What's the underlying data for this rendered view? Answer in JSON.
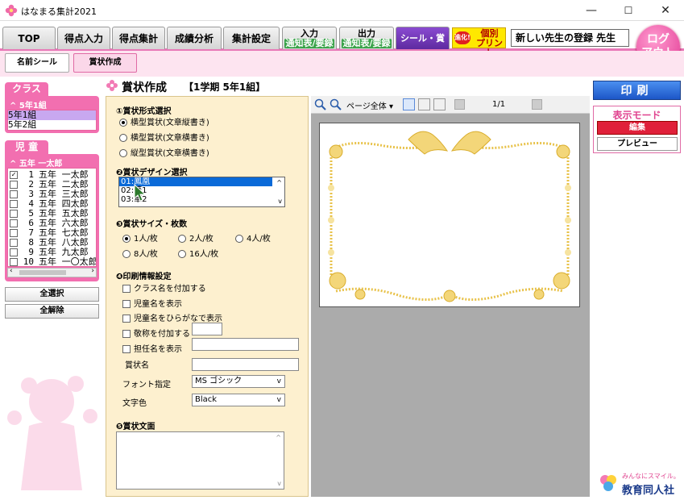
{
  "window": {
    "title": "はなまる集計2021",
    "minimize": "—",
    "maximize": "☐",
    "close": "✕"
  },
  "tabs": [
    {
      "label": "TOP"
    },
    {
      "label": "得点入力"
    },
    {
      "label": "得点集計"
    },
    {
      "label": "成績分析"
    },
    {
      "label": "集計設定"
    },
    {
      "label": "入力",
      "sub": "通知表/要録"
    },
    {
      "label": "出力",
      "sub": "通知表/要録"
    },
    {
      "label": "シール・賞状"
    }
  ],
  "promo": {
    "badge": "進化!",
    "line1": "個別",
    "line2": "プリント"
  },
  "user": {
    "name": "新しい先生の登録 先生"
  },
  "logout": {
    "line1": "ログ",
    "line2": "アウト"
  },
  "subtabs": [
    "名前シール",
    "賞状作成"
  ],
  "page": {
    "title": "賞状作成",
    "context": "【1学期 5年1組】"
  },
  "class_panel": {
    "header": "クラス",
    "current": "5年1組",
    "items": [
      "5年1組",
      "5年2組"
    ]
  },
  "student_panel": {
    "header": "児 童",
    "current": "五年 一太郎",
    "students": [
      {
        "no": "1",
        "name": "五年 一太郎",
        "checked": true
      },
      {
        "no": "2",
        "name": "五年 二太郎",
        "checked": false
      },
      {
        "no": "3",
        "name": "五年 三太郎",
        "checked": false
      },
      {
        "no": "4",
        "name": "五年 四太郎",
        "checked": false
      },
      {
        "no": "5",
        "name": "五年 五太郎",
        "checked": false
      },
      {
        "no": "6",
        "name": "五年 六太郎",
        "checked": false
      },
      {
        "no": "7",
        "name": "五年 七太郎",
        "checked": false
      },
      {
        "no": "8",
        "name": "五年 八太郎",
        "checked": false
      },
      {
        "no": "9",
        "name": "五年 九太郎",
        "checked": false
      },
      {
        "no": "10",
        "name": "五年 一〇太郎",
        "checked": false
      }
    ]
  },
  "buttons": {
    "select_all": "全選択",
    "deselect_all": "全解除",
    "print": "印刷"
  },
  "form": {
    "s1": {
      "label": "①賞状形式選択",
      "options": [
        "横型賞状(文章縦書き)",
        "横型賞状(文章横書き)",
        "縦型賞状(文章横書き)"
      ],
      "selected": 0
    },
    "s2": {
      "label": "❷賞状デザイン選択",
      "items": [
        "01:鳳凰",
        "02:華1",
        "03:華2"
      ],
      "selected": 0
    },
    "s3": {
      "label": "❸賞状サイズ・枚数",
      "options": [
        "1人/枚",
        "2人/枚",
        "4人/枚",
        "8人/枚",
        "16人/枚"
      ],
      "selected": 0
    },
    "s4": {
      "label": "❹印刷情報設定",
      "checks": [
        "クラス名を付加する",
        "児童名を表示",
        "児童名をひらがなで表示",
        "敬称を付加する",
        "担任名を表示"
      ],
      "award_name_label": "賞状名",
      "font_label": "フォント指定",
      "font_value": "MS ゴシック",
      "color_label": "文字色",
      "color_value": "Black"
    },
    "s5": {
      "label": "❺賞状文面"
    }
  },
  "preview": {
    "zoom": "ページ全体",
    "page_indicator": "1/1"
  },
  "mode": {
    "title": "表示モード",
    "edit": "編集",
    "preview": "プレビュー"
  },
  "footer": {
    "tagline": "みんなにスマイル。",
    "company": "教育同人社"
  },
  "colors": {
    "accent": "#e879b8",
    "seal_tab": "#6a35b0",
    "print": "#1c56c7",
    "frame_gold": "#e8c24a"
  }
}
